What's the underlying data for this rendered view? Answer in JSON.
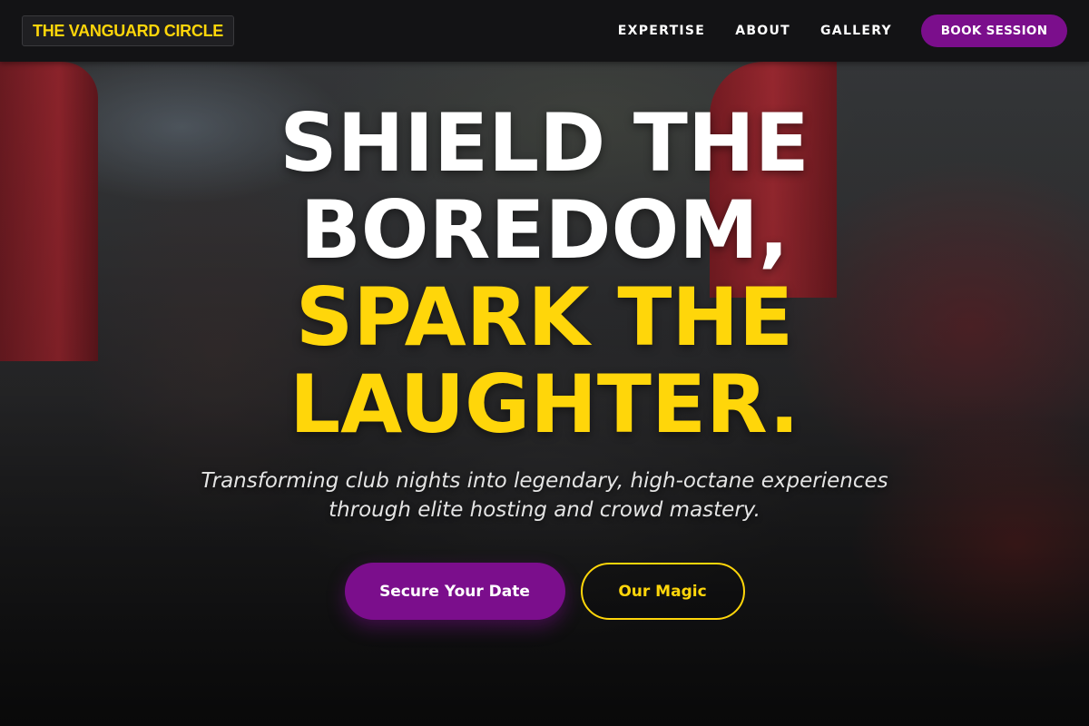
{
  "brand": {
    "name": "THE VANGUARD CIRCLE"
  },
  "nav": {
    "links": [
      {
        "label": "EXPERTISE"
      },
      {
        "label": "ABOUT"
      },
      {
        "label": "GALLERY"
      }
    ],
    "cta_label": "BOOK SESSION"
  },
  "hero": {
    "headline_line1": "SHIELD THE",
    "headline_line2": "BOREDOM,",
    "headline_line3": "SPARK THE",
    "headline_line4": "LAUGHTER.",
    "subtitle": "Transforming club nights into legendary, high-octane experiences through elite hosting and crowd mastery.",
    "primary_button": "Secure Your Date",
    "secondary_button": "Our Magic"
  },
  "colors": {
    "accent_yellow": "#ffd60a",
    "accent_purple": "#7b0e8c",
    "nav_background": "#121214"
  },
  "background_image": {
    "description": "motorcycle-racing-track-photo"
  }
}
